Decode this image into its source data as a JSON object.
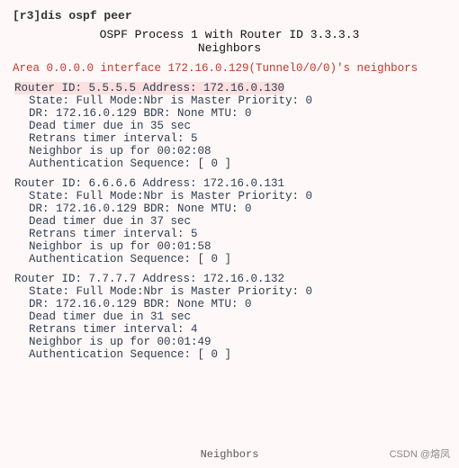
{
  "terminal": {
    "command": "[r3]dis ospf peer",
    "header_line1": "OSPF Process 1 with Router ID 3.3.3.3",
    "header_line2": "Neighbors",
    "area_line": "Area 0.0.0.0 interface 172.16.0.129(Tunnel0/0/0)'s neighbors",
    "neighbors": [
      {
        "router_id": "5.5.5.5",
        "address": "172.16.0.130",
        "state_line": "State: Full  Mode:Nbr is  Master  Priority: 0",
        "dr_line": "DR: 172.16.0.129  BDR: None   MTU: 0",
        "dead_timer": "Dead timer due in 35 sec",
        "retrans": "Retrans timer interval: 5",
        "uptime": "Neighbor is up for 00:02:08",
        "auth": "Authentication Sequence: [ 0 ]"
      },
      {
        "router_id": "6.6.6.6",
        "address": "172.16.0.131",
        "state_line": "State: Full  Mode:Nbr is  Master  Priority: 0",
        "dr_line": "DR: 172.16.0.129  BDR: None   MTU: 0",
        "dead_timer": "Dead timer due in 37 sec",
        "retrans": "Retrans timer interval: 5",
        "uptime": "Neighbor is up for 00:01:58",
        "auth": "Authentication Sequence: [ 0 ]"
      },
      {
        "router_id": "7.7.7.7",
        "address": "172.16.0.132",
        "state_line": "State: Full  Mode:Nbr is  Master  Priority: 0",
        "dr_line": "DR: 172.16.0.129  BDR: None   MTU: 0",
        "dead_timer": "Dead timer due in 31 sec",
        "retrans": "Retrans timer interval: 4",
        "uptime": "Neighbor is up for 00:01:49",
        "auth": "Authentication Sequence: [ 0 ]"
      }
    ],
    "footer": "Neighbors",
    "watermark": "CSDN @熔凤"
  }
}
